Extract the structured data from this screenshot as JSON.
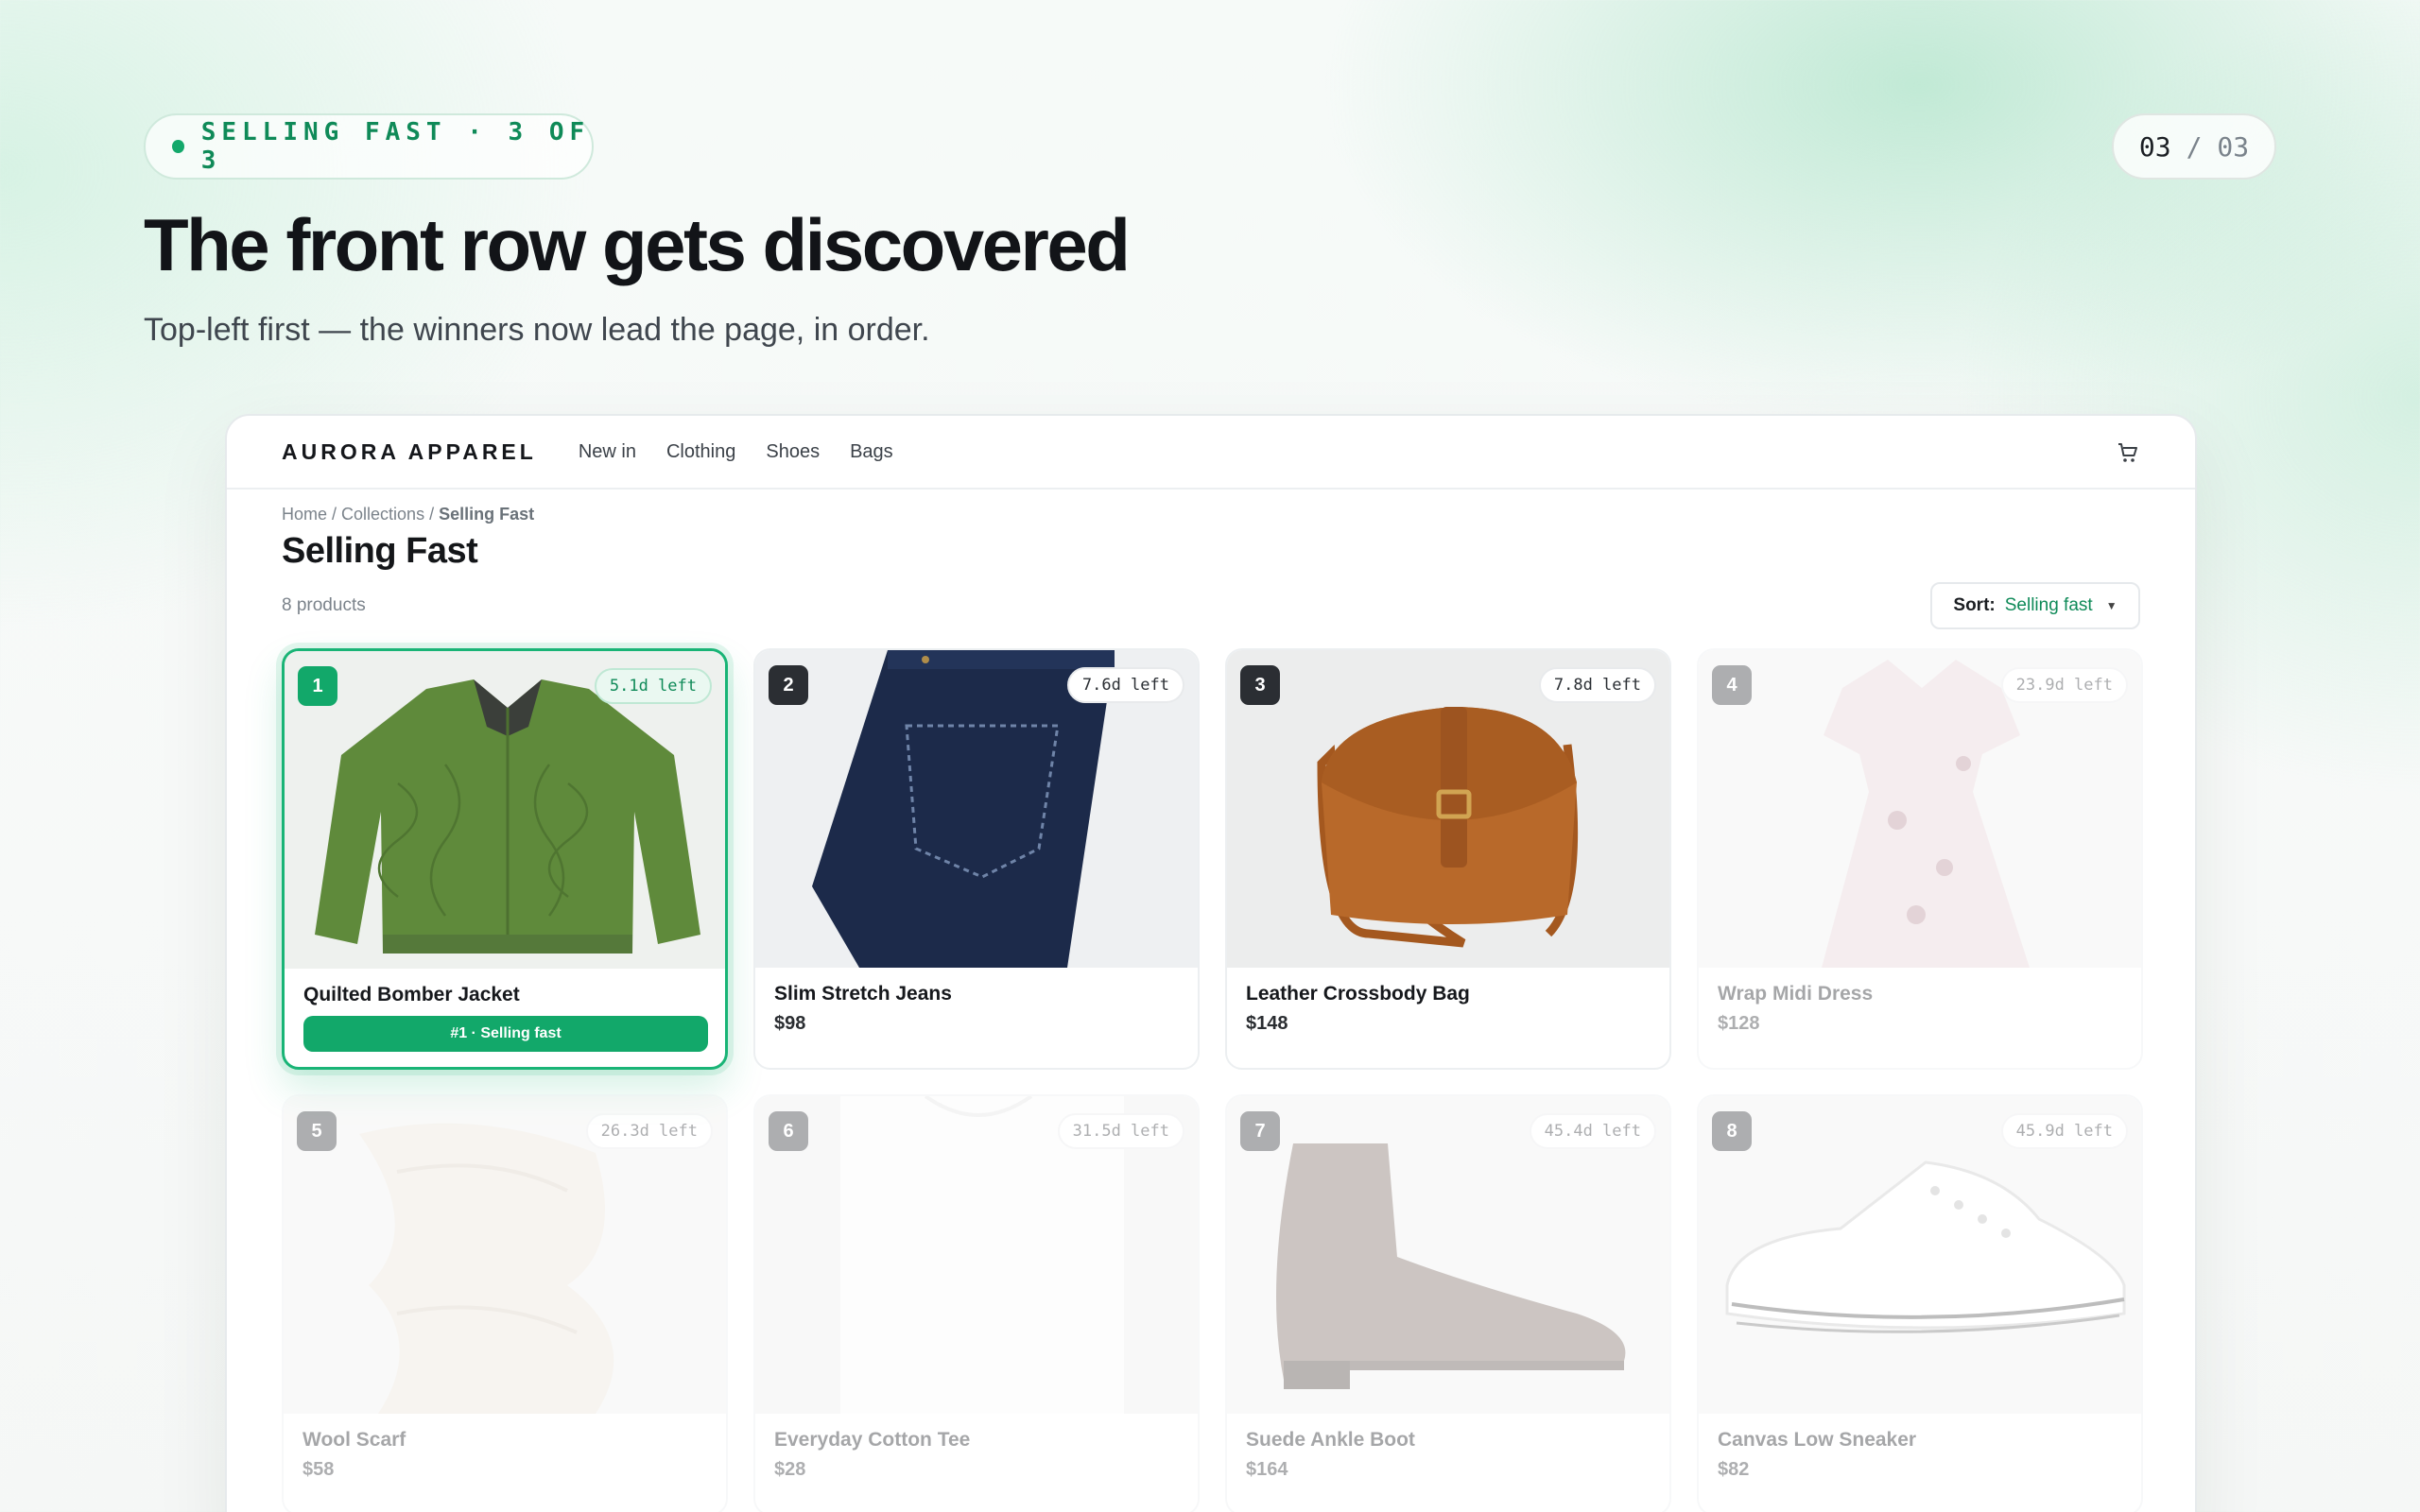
{
  "slide": {
    "badge_text": "SELLING FAST · 3 OF 3",
    "pager_current": "03",
    "pager_sep": "/",
    "pager_total": "03",
    "headline": "The front row gets discovered",
    "subhead": "Top-left first — the winners now lead the page, in order."
  },
  "store": {
    "brand": "AURORA APPAREL",
    "nav": [
      "New in",
      "Clothing",
      "Shoes",
      "Bags"
    ],
    "breadcrumb": {
      "home": "Home",
      "sep1": " / ",
      "collections": "Collections",
      "sep2": " / ",
      "current": "Selling Fast"
    },
    "page_title": "Selling Fast",
    "product_count": "8 products",
    "sort_label": "Sort:",
    "sort_value": "Selling fast"
  },
  "products": [
    {
      "rank": "1",
      "timer": "5.1d left",
      "name": "Quilted Bomber Jacket",
      "badge": "#1 · Selling fast"
    },
    {
      "rank": "2",
      "timer": "7.6d left",
      "name": "Slim Stretch Jeans",
      "price": "$98"
    },
    {
      "rank": "3",
      "timer": "7.8d left",
      "name": "Leather Crossbody Bag",
      "price": "$148"
    },
    {
      "rank": "4",
      "timer": "23.9d left",
      "name": "Wrap Midi Dress",
      "price": "$128"
    },
    {
      "rank": "5",
      "timer": "26.3d left",
      "name": "Wool Scarf",
      "price": "$58"
    },
    {
      "rank": "6",
      "timer": "31.5d left",
      "name": "Everyday Cotton Tee",
      "price": "$28"
    },
    {
      "rank": "7",
      "timer": "45.4d left",
      "name": "Suede Ankle Boot",
      "price": "$164"
    },
    {
      "rank": "8",
      "timer": "45.9d left",
      "name": "Canvas Low Sneaker",
      "price": "$82"
    }
  ],
  "colors": {
    "accent": "#12a86a",
    "accent_text": "#0f8a58",
    "rank_dark": "#2b2e33"
  }
}
